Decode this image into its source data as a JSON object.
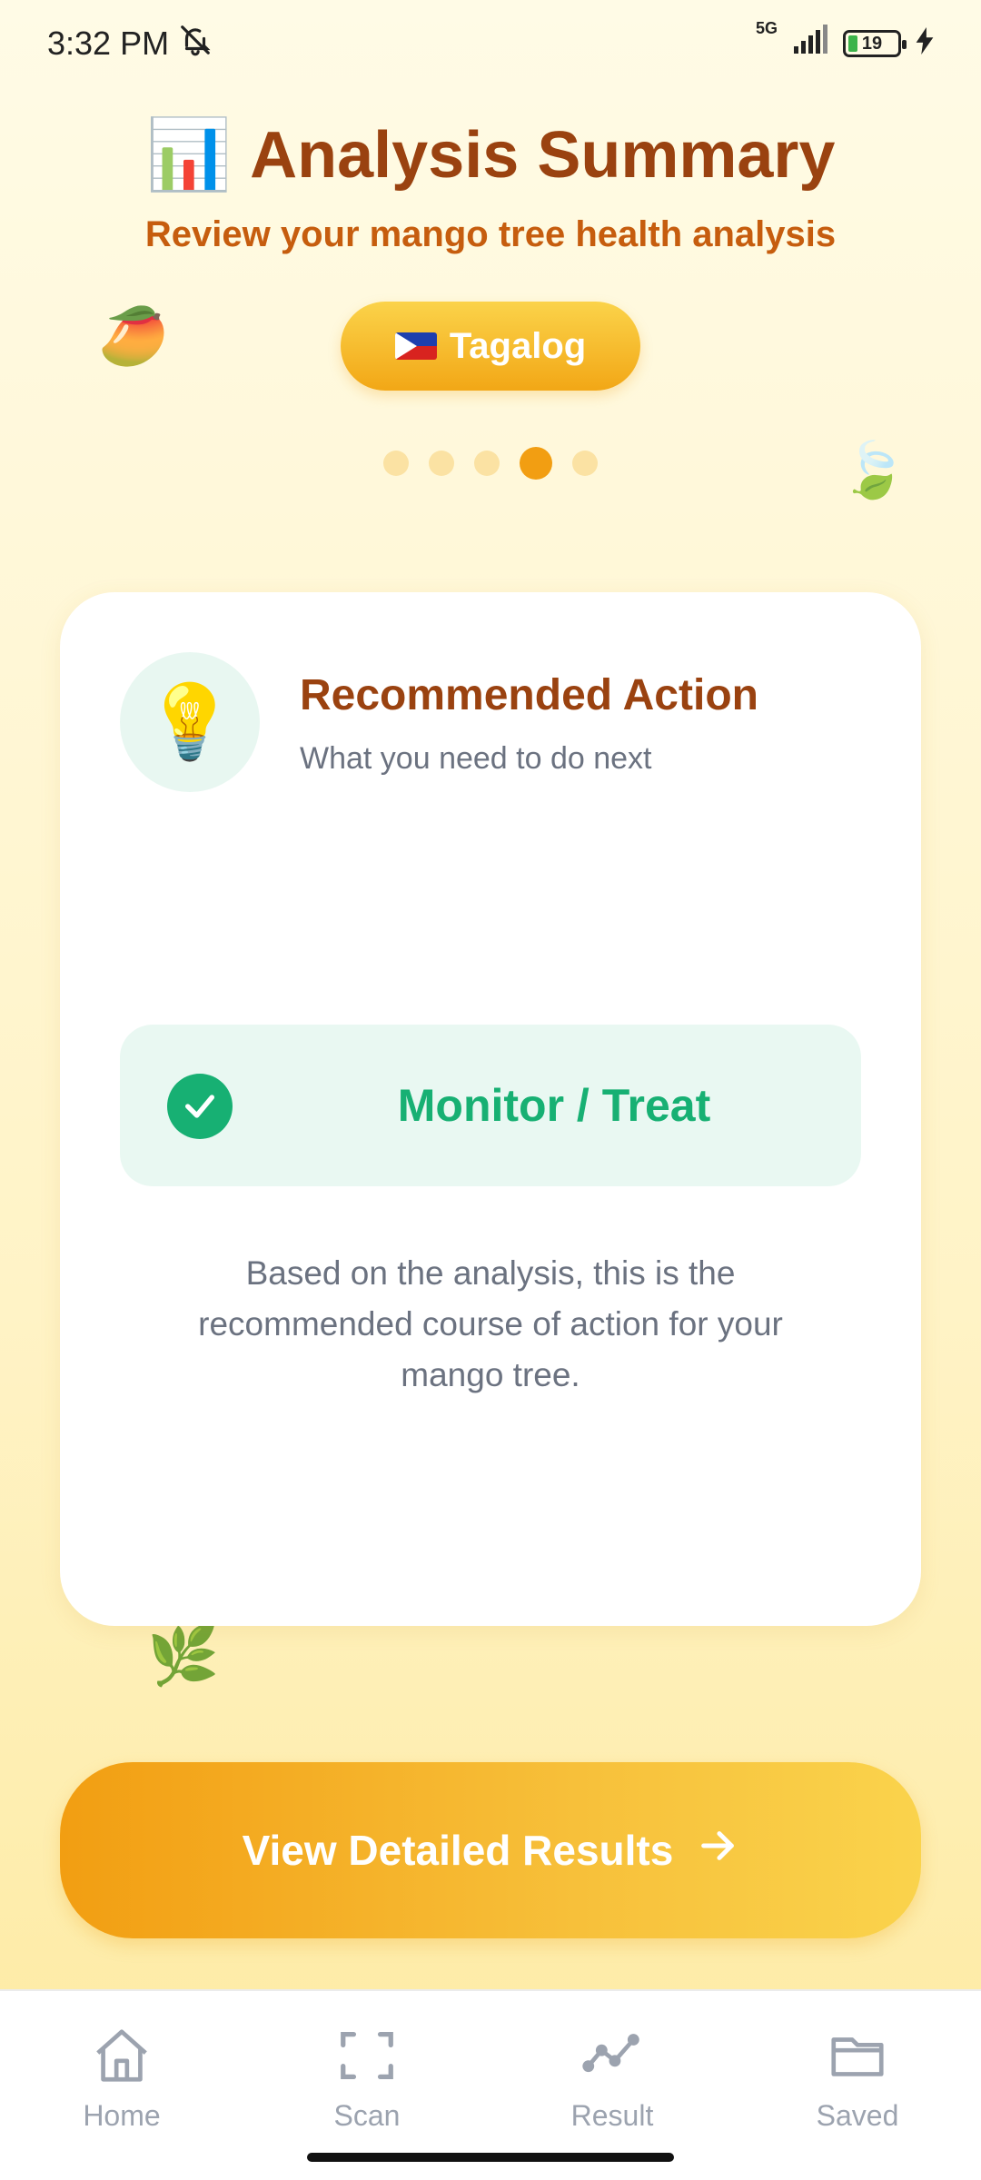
{
  "status_bar": {
    "time": "3:32 PM",
    "network": "5G",
    "battery": "19"
  },
  "header": {
    "title_icon": "📊",
    "title": "Analysis Summary",
    "subtitle": "Review your mango tree health analysis",
    "language_button": {
      "label": "Tagalog",
      "flag": "philippines-flag"
    }
  },
  "pager": {
    "total": 5,
    "active_index": 3
  },
  "card": {
    "icon": "💡",
    "title": "Recommended Action",
    "subtitle": "What you need to do next",
    "action": "Monitor / Treat",
    "description": "Based on the analysis, this is the recommended course of action for your mango tree."
  },
  "cta": {
    "label": "View Detailed Results",
    "icon": "arrow-right-icon"
  },
  "bottom_nav": {
    "items": [
      {
        "label": "Home",
        "icon": "home-icon"
      },
      {
        "label": "Scan",
        "icon": "scan-icon"
      },
      {
        "label": "Result",
        "icon": "result-chart-icon"
      },
      {
        "label": "Saved",
        "icon": "folder-icon"
      }
    ]
  },
  "colors": {
    "title": "#9a4210",
    "subtitle": "#c65d0e",
    "accent": "#f29e12",
    "success": "#17b073"
  }
}
